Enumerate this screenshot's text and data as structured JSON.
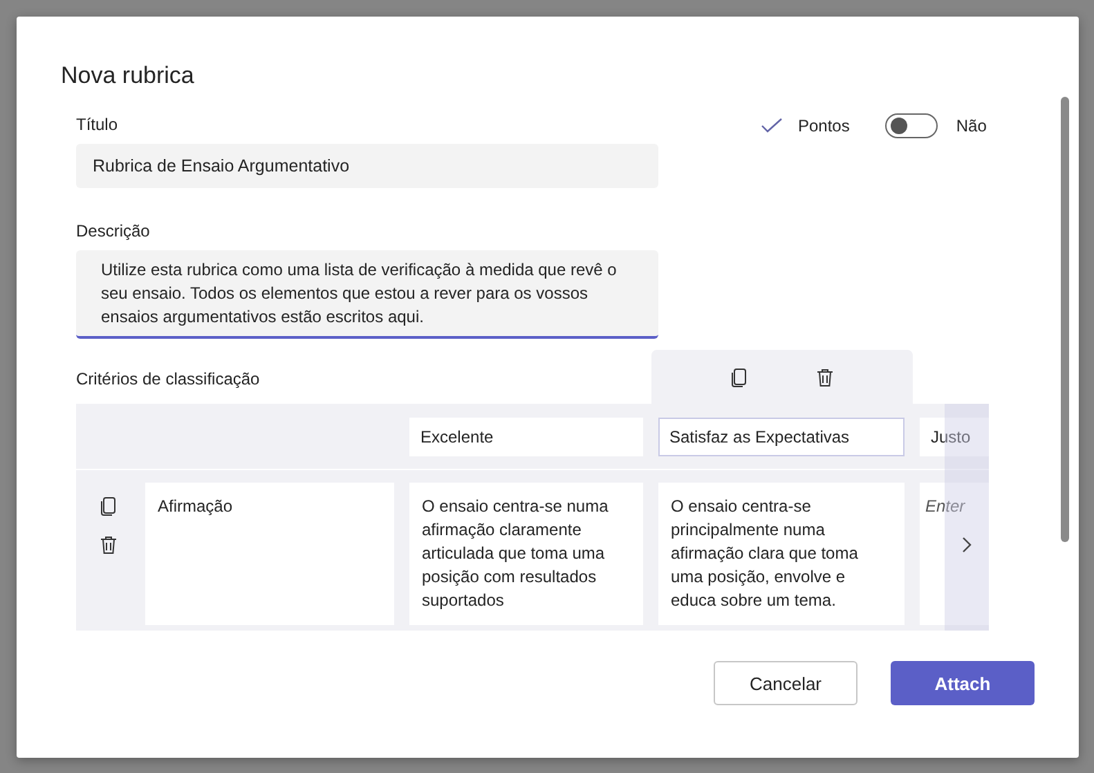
{
  "dialog": {
    "title": "Nova rubrica"
  },
  "title_field": {
    "label": "Título",
    "value": "Rubrica de Ensaio Argumentativo"
  },
  "points": {
    "label": "Pontos",
    "on": false,
    "state_label": "Não"
  },
  "description_field": {
    "label": "Descrição",
    "value": "Utilize esta rubrica como uma lista de verificação à medida que revê o seu ensaio. Todos os elementos que estou a rever para os vossos ensaios argumentativos estão escritos aqui.",
    "focused": true
  },
  "criteria": {
    "label": "Critérios de classificação",
    "levels": [
      {
        "title": "Excelente",
        "selected": false
      },
      {
        "title": "Satisfaz as Expectativas",
        "selected": true
      },
      {
        "title": "Justo",
        "selected": false
      }
    ],
    "rows": [
      {
        "name": "Afirmação",
        "cells": [
          {
            "value": "O ensaio centra-se numa afirmação claramente articulada que toma uma posição com resultados suportados"
          },
          {
            "value": "O ensaio centra-se principalmente numa afirmação clara que toma uma posição, envolve e educa sobre um tema."
          },
          {
            "placeholder": "Enter"
          }
        ]
      }
    ]
  },
  "buttons": [
    {
      "label": "Cancelar",
      "kind": "secondary"
    },
    {
      "label": "Attach",
      "kind": "primary"
    }
  ]
}
